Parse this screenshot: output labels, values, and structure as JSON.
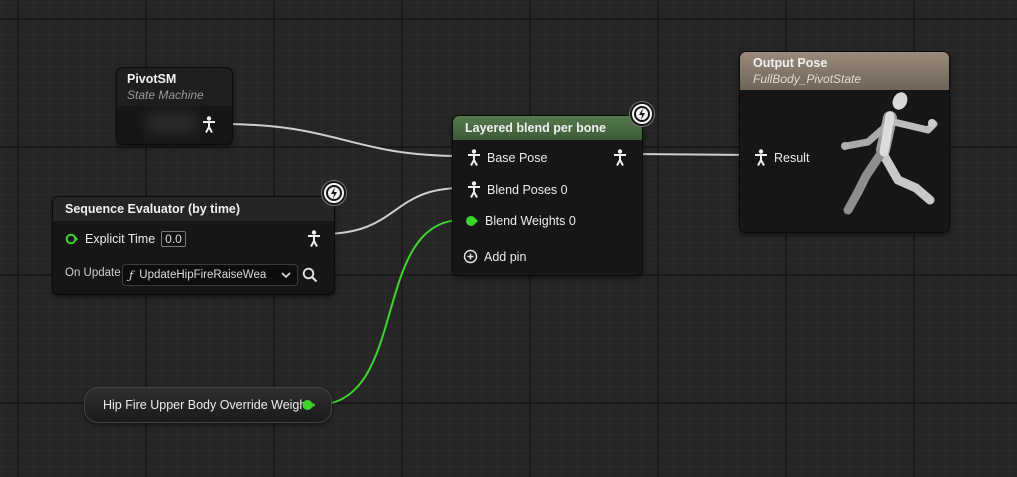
{
  "nodes": {
    "pivot_sm": {
      "title": "PivotSM",
      "subtitle": "State Machine"
    },
    "sequence_evaluator": {
      "title": "Sequence Evaluator (by time)",
      "explicit_time_label": "Explicit Time",
      "explicit_time_value": "0.0",
      "on_update_label": "On Update",
      "on_update_function": "UpdateHipFireRaiseWea"
    },
    "layered_blend": {
      "title": "Layered blend per bone",
      "base_pose_label": "Base Pose",
      "blend_poses_label": "Blend Poses 0",
      "blend_weights_label": "Blend Weights 0",
      "add_pin_label": "Add pin"
    },
    "output_pose": {
      "title": "Output Pose",
      "subtitle": "FullBody_PivotState",
      "result_label": "Result"
    },
    "hip_fire_variable": {
      "label": "Hip Fire Upper Body Override Weight"
    }
  },
  "colors": {
    "graph_bg": "#262626",
    "exec_wire": "#d8d8d8",
    "float_pin": "#3ed42e",
    "blend_header": "#4a6a45",
    "output_header": "#8a7d6f"
  }
}
